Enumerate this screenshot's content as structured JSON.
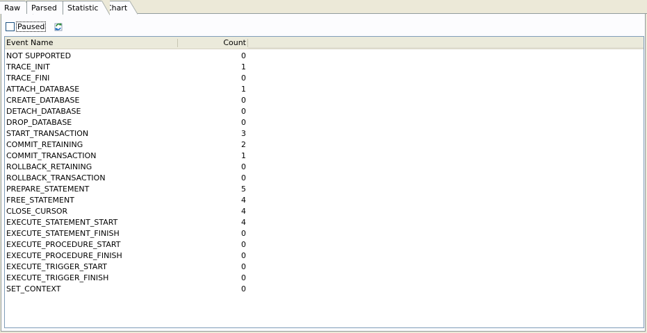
{
  "tabs": [
    {
      "label": "Raw"
    },
    {
      "label": "Parsed"
    },
    {
      "label": "Statistic"
    },
    {
      "label": "Chart"
    }
  ],
  "active_tab": "Statistic",
  "toolbar": {
    "paused_label": "Paused",
    "paused_checked": false,
    "refresh_icon": "refresh-icon"
  },
  "table": {
    "columns": [
      "Event Name",
      "Count"
    ],
    "rows": [
      {
        "name": "NOT SUPPORTED",
        "count": "0"
      },
      {
        "name": "TRACE_INIT",
        "count": "1"
      },
      {
        "name": "TRACE_FINI",
        "count": "0"
      },
      {
        "name": "ATTACH_DATABASE",
        "count": "1"
      },
      {
        "name": "CREATE_DATABASE",
        "count": "0"
      },
      {
        "name": "DETACH_DATABASE",
        "count": "0"
      },
      {
        "name": "DROP_DATABASE",
        "count": "0"
      },
      {
        "name": "START_TRANSACTION",
        "count": "3"
      },
      {
        "name": "COMMIT_RETAINING",
        "count": "2"
      },
      {
        "name": "COMMIT_TRANSACTION",
        "count": "1"
      },
      {
        "name": "ROLLBACK_RETAINING",
        "count": "0"
      },
      {
        "name": "ROLLBACK_TRANSACTION",
        "count": "0"
      },
      {
        "name": "PREPARE_STATEMENT",
        "count": "5"
      },
      {
        "name": "FREE_STATEMENT",
        "count": "4"
      },
      {
        "name": "CLOSE_CURSOR",
        "count": "4"
      },
      {
        "name": "EXECUTE_STATEMENT_START",
        "count": "4"
      },
      {
        "name": "EXECUTE_STATEMENT_FINISH",
        "count": "0"
      },
      {
        "name": "EXECUTE_PROCEDURE_START",
        "count": "0"
      },
      {
        "name": "EXECUTE_PROCEDURE_FINISH",
        "count": "0"
      },
      {
        "name": "EXECUTE_TRIGGER_START",
        "count": "0"
      },
      {
        "name": "EXECUTE_TRIGGER_FINISH",
        "count": "0"
      },
      {
        "name": "SET_CONTEXT",
        "count": "0"
      }
    ]
  }
}
